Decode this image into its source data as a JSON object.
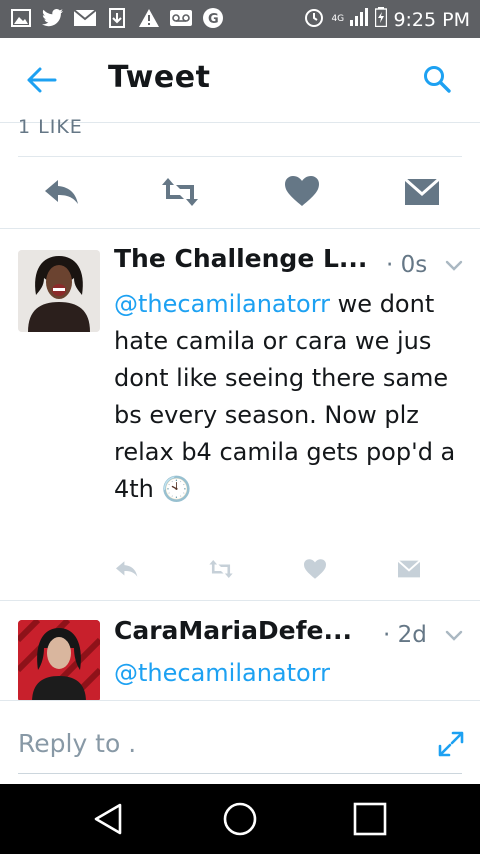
{
  "status_bar": {
    "time": "9:25 PM",
    "network": "4G",
    "notification_icons": [
      "image-icon",
      "twitter-icon",
      "mail-icon",
      "download-icon",
      "warning-icon",
      "voicemail-icon",
      "google-icon"
    ]
  },
  "app_bar": {
    "title": "Tweet"
  },
  "likes_label": "1 LIKE",
  "tweets": [
    {
      "name": "The Challenge L...",
      "time": "· 0s",
      "mention": "@thecamilanatorr",
      "text": " we dont hate camila or cara we jus dont like seeing there same bs every season. Now plz relax b4 camila gets pop'd a 4th 🕙"
    },
    {
      "name": "CaraMariaDefe...",
      "time": "· 2d",
      "mention": "@thecamilanatorr",
      "text": ""
    }
  ],
  "reply": {
    "placeholder": "Reply to ."
  },
  "colors": {
    "accent": "#1da1f2",
    "icon_gray": "#657786",
    "status_bar": "#5e6064"
  }
}
